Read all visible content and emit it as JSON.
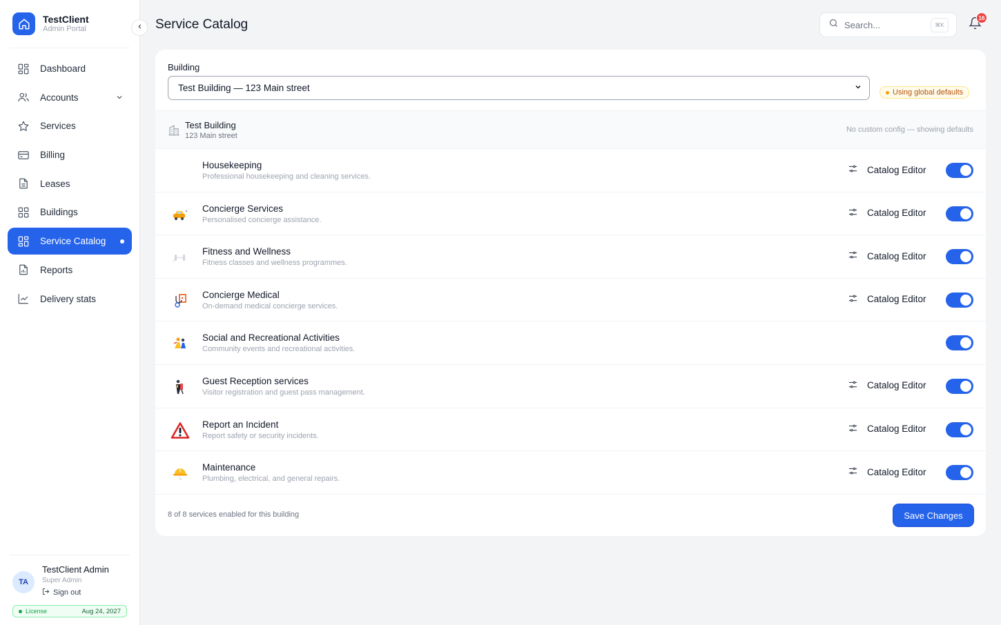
{
  "brand": {
    "title": "TestClient",
    "subtitle": "Admin Portal"
  },
  "nav": [
    {
      "label": "Dashboard",
      "icon": "dashboard-grid-icon",
      "active": false
    },
    {
      "label": "Accounts",
      "icon": "users-icon",
      "active": false,
      "expandable": true
    },
    {
      "label": "Services",
      "icon": "star-icon",
      "active": false
    },
    {
      "label": "Billing",
      "icon": "credit-card-icon",
      "active": false
    },
    {
      "label": "Leases",
      "icon": "document-icon",
      "active": false
    },
    {
      "label": "Buildings",
      "icon": "buildings-grid-icon",
      "active": false
    },
    {
      "label": "Service Catalog",
      "icon": "catalog-grid-icon",
      "active": true
    },
    {
      "label": "Reports",
      "icon": "report-icon",
      "active": false
    },
    {
      "label": "Delivery stats",
      "icon": "line-chart-icon",
      "active": false
    }
  ],
  "user": {
    "initials": "TA",
    "name": "TestClient Admin",
    "role": "Super Admin",
    "signout": "Sign out"
  },
  "license": {
    "label": "License",
    "date": "Aug 24, 2027"
  },
  "header": {
    "title": "Service Catalog",
    "search_placeholder": "Search...",
    "shortcut": "⌘K",
    "notifications": "16"
  },
  "building": {
    "label": "Building",
    "selected": "Test Building — 123 Main street",
    "status_pill": "Using global defaults",
    "name": "Test Building",
    "address": "123 Main street",
    "note": "No custom config — showing defaults"
  },
  "services": [
    {
      "name": "Housekeeping",
      "description": "Professional housekeeping and cleaning services.",
      "icon": "",
      "editor": "Catalog Editor",
      "enabled": true
    },
    {
      "name": "Concierge Services",
      "description": "Personalised concierge assistance.",
      "icon": "concierge-car-icon",
      "editor": "Catalog Editor",
      "enabled": true
    },
    {
      "name": "Fitness and Wellness",
      "description": "Fitness classes and wellness programmes.",
      "icon": "dumbbell-icon",
      "editor": "Catalog Editor",
      "enabled": true
    },
    {
      "name": "Concierge Medical",
      "description": "On-demand medical concierge services.",
      "icon": "stethoscope-icon",
      "editor": "Catalog Editor",
      "enabled": true
    },
    {
      "name": "Social and Recreational Activities",
      "description": "Community events and recreational activities.",
      "icon": "people-activity-icon",
      "editor": "",
      "enabled": true
    },
    {
      "name": "Guest Reception services",
      "description": "Visitor registration and guest pass management.",
      "icon": "reception-icon",
      "editor": "Catalog Editor",
      "enabled": true
    },
    {
      "name": "Report an Incident",
      "description": "Report safety or security incidents.",
      "icon": "warning-triangle-icon",
      "editor": "Catalog Editor",
      "enabled": true
    },
    {
      "name": "Maintenance",
      "description": "Plumbing, electrical, and general repairs.",
      "icon": "hard-hat-icon",
      "editor": "Catalog Editor",
      "enabled": true
    }
  ],
  "footer": {
    "summary": "8 of 8 services enabled for this building",
    "save_label": "Save Changes"
  },
  "colors": {
    "accent": "#2563eb",
    "warning": "#b45309",
    "success": "#16a34a",
    "danger": "#ef4444"
  }
}
